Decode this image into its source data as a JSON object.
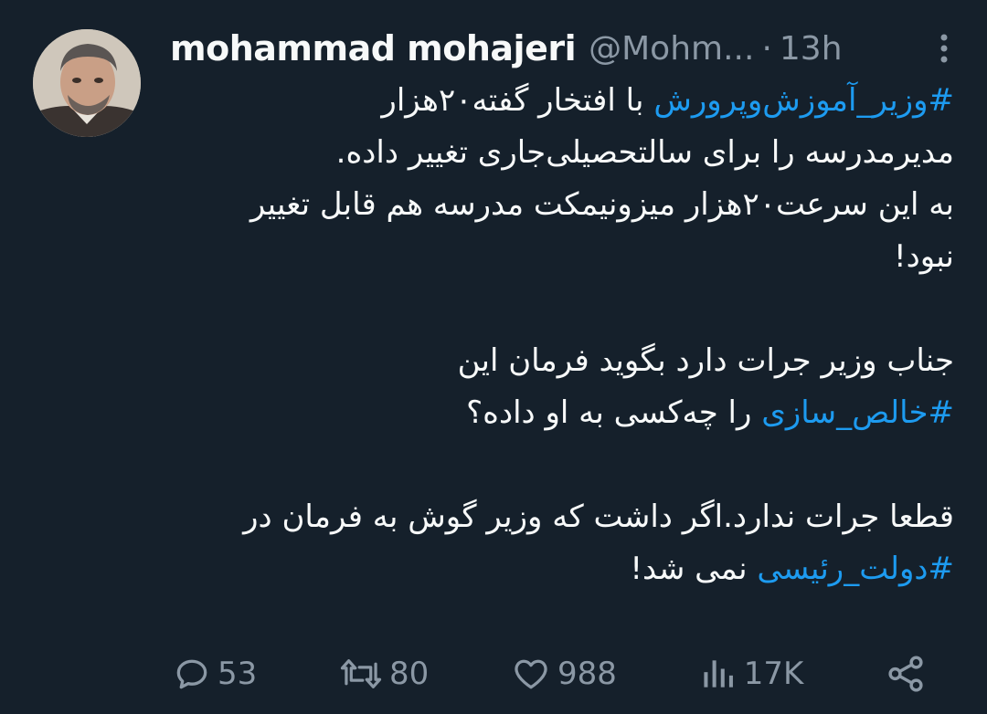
{
  "tweet": {
    "author_name": "mohammad mohajeri",
    "author_handle": "@Mohm...",
    "separator": "·",
    "time": "13h",
    "lines": [
      {
        "type": "mixed",
        "parts": [
          {
            "text": "#وزیر_آموزش‌وپرورش",
            "hashtag": true
          },
          {
            "text": " با افتخار گفته۲۰هزار",
            "hashtag": false
          }
        ]
      },
      {
        "type": "text",
        "text": "مدیرمدرسه را برای سالتحصیلی‌جاری تغییر داده."
      },
      {
        "type": "text",
        "text": "به این سرعت۲۰هزار میزونیمکت مدرسه هم قابل تغییر"
      },
      {
        "type": "text",
        "text": "نبود!"
      },
      {
        "type": "blank"
      },
      {
        "type": "text",
        "text": "جناب وزیر جرات دارد بگوید فرمان این"
      },
      {
        "type": "mixed",
        "parts": [
          {
            "text": "#خالص_سازی",
            "hashtag": true
          },
          {
            "text": " را چه‌کسی به او داده؟",
            "hashtag": false
          }
        ]
      },
      {
        "type": "blank"
      },
      {
        "type": "text",
        "text": "قطعا جرات ندارد.اگر داشت که وزیر گوش به فرمان در"
      },
      {
        "type": "mixed",
        "parts": [
          {
            "text": "#دولت_رئیسی",
            "hashtag": true
          },
          {
            "text": "  نمی شد!",
            "hashtag": false
          }
        ]
      }
    ]
  },
  "actions": {
    "replies": "53",
    "retweets": "80",
    "likes": "988",
    "views": "17K"
  },
  "colors": {
    "background": "#15202b",
    "text": "#f7f9f9",
    "muted": "#8b98a5",
    "accent": "#1d9bf0"
  },
  "icons": {
    "reply": "reply-icon",
    "retweet": "retweet-icon",
    "like": "heart-icon",
    "views": "views-chart-icon",
    "share": "share-icon",
    "more": "more-vertical-icon"
  }
}
